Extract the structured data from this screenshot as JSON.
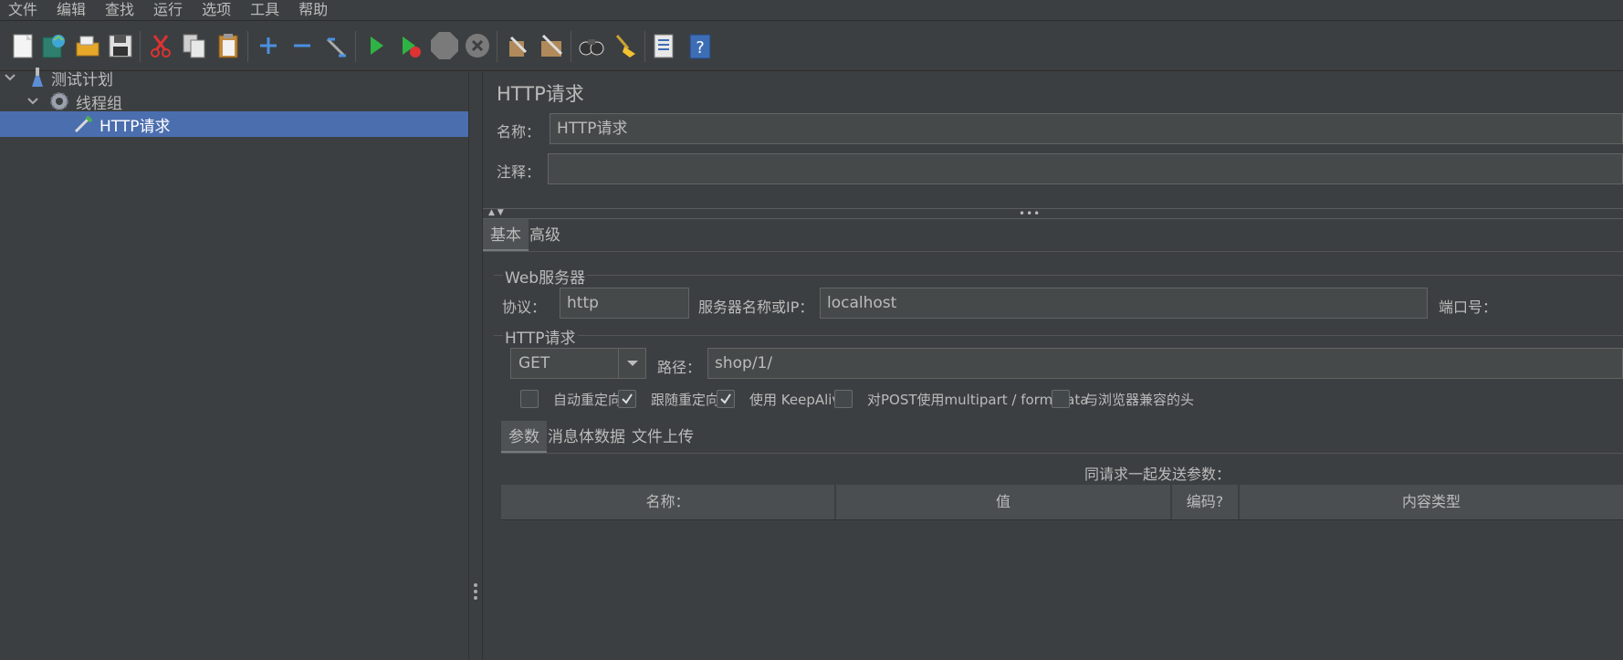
{
  "menu": [
    "文件",
    "编辑",
    "查找",
    "运行",
    "选项",
    "工具",
    "帮助"
  ],
  "toolbar": {
    "icons": [
      "new-icon",
      "templates-icon",
      "open-icon",
      "save-icon",
      "cut-icon",
      "copy-icon",
      "paste-icon",
      "expand-icon",
      "collapse-icon",
      "toggle-icon",
      "start-icon",
      "start-no-pause-icon",
      "stop-icon",
      "shutdown-icon",
      "clear-icon",
      "clear-all-icon",
      "search-icon",
      "reset-search-icon",
      "function-helper-icon",
      "help-icon"
    ]
  },
  "tree": {
    "items": [
      {
        "label": "测试计划",
        "icon": "flask-icon"
      },
      {
        "label": "线程组",
        "icon": "gear-icon"
      },
      {
        "label": "HTTP请求",
        "icon": "pipette-icon",
        "selected": true
      }
    ]
  },
  "sampler": {
    "title": "HTTP请求",
    "name_label": "名称：",
    "name_value": "HTTP请求",
    "comment_label": "注释：",
    "comment_value": ""
  },
  "config_tabs": [
    {
      "label": "基本",
      "active": true
    },
    {
      "label": "高级",
      "active": false
    }
  ],
  "web_server": {
    "title": "Web服务器",
    "protocol_label": "协议：",
    "protocol_value": "http",
    "server_label": "服务器名称或IP：",
    "server_value": "localhost",
    "port_label": "端口号："
  },
  "http_request": {
    "title": "HTTP请求",
    "method": "GET",
    "path_label": "路径：",
    "path_value": "shop/1/",
    "options": [
      {
        "label": "自动重定向",
        "checked": false
      },
      {
        "label": "跟随重定向",
        "checked": true
      },
      {
        "label": "使用 KeepAlive",
        "checked": true
      },
      {
        "label": "对POST使用multipart / form-data",
        "checked": false
      },
      {
        "label": "与浏览器兼容的头",
        "checked": false
      }
    ]
  },
  "param_tabs": [
    {
      "label": "参数",
      "active": true
    },
    {
      "label": "消息体数据",
      "active": false
    },
    {
      "label": "文件上传",
      "active": false
    }
  ],
  "params_table": {
    "caption": "同请求一起发送参数：",
    "columns": [
      "名称：",
      "值",
      "编码?",
      "内容类型"
    ]
  },
  "colors": {
    "background": "#3c3f41",
    "selection": "#4b6eaf",
    "field": "#45494a"
  }
}
